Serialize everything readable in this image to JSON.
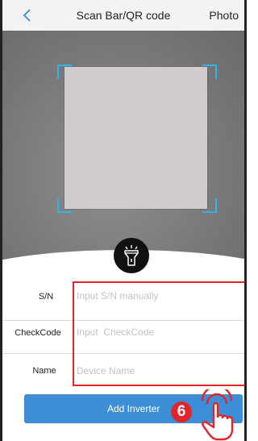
{
  "navbar": {
    "title": "Scan Bar/QR code",
    "photo_label": "Photo",
    "back_icon": "chevron-left-icon"
  },
  "scanner": {
    "frame_color": "#35b3e8",
    "flashlight_icon": "flashlight-icon"
  },
  "form": {
    "fields": [
      {
        "label": "S/N",
        "placeholder": "Input S/N manually"
      },
      {
        "label": "CheckCode",
        "placeholder": "Input  CheckCode"
      },
      {
        "label": "Name",
        "placeholder": "Device Name"
      }
    ],
    "highlight_color": "#e0262b"
  },
  "actions": {
    "add_inverter_label": "Add Inverter",
    "button_color": "#3c8fd6"
  },
  "annotation": {
    "step_number": "6",
    "pointer_icon": "hand-pointer-icon"
  }
}
